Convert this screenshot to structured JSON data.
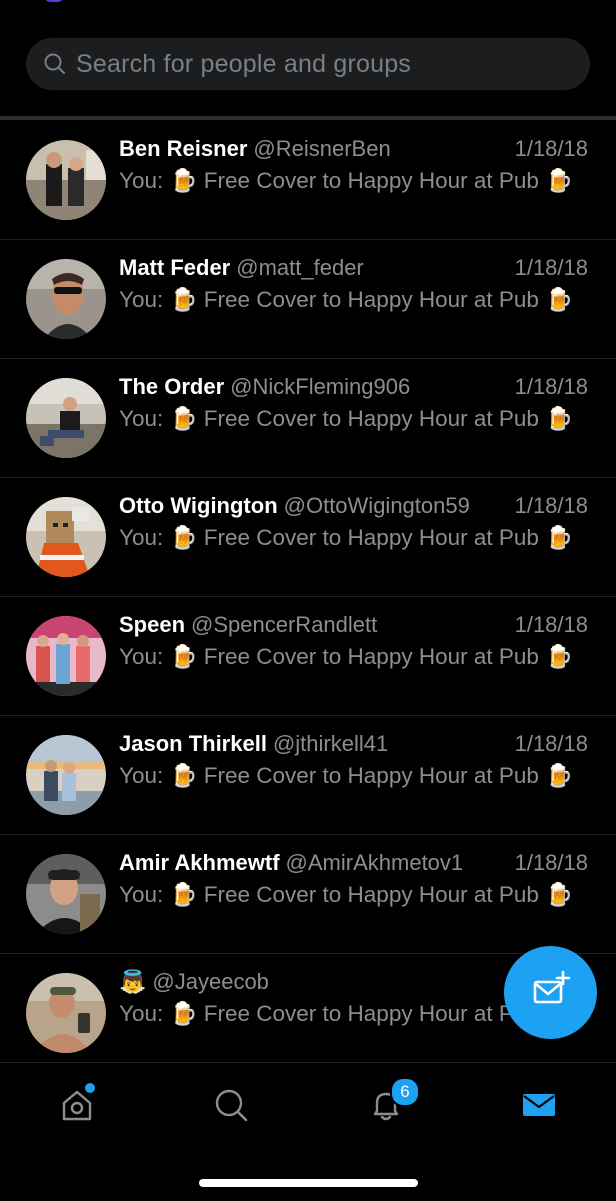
{
  "search": {
    "placeholder": "Search for people and groups",
    "icon": "search-icon"
  },
  "conversations": [
    {
      "name": "Ben Reisner",
      "handle": "@ReisnerBen",
      "date": "1/18/18",
      "preview": "You: 🍺 Free Cover to Happy Hour at Pub 🍺"
    },
    {
      "name": "Matt Feder",
      "handle": "@matt_feder",
      "date": "1/18/18",
      "preview": "You: 🍺 Free Cover to Happy Hour at Pub 🍺"
    },
    {
      "name": "The Order",
      "handle": "@NickFleming906",
      "date": "1/18/18",
      "preview": "You: 🍺 Free Cover to Happy Hour at Pub 🍺"
    },
    {
      "name": "Otto Wigington",
      "handle": "@OttoWigington59",
      "date": "1/18/18",
      "preview": "You: 🍺 Free Cover to Happy Hour at Pub 🍺"
    },
    {
      "name": "Speen",
      "handle": "@SpencerRandlett",
      "date": "1/18/18",
      "preview": "You: 🍺 Free Cover to Happy Hour at Pub 🍺"
    },
    {
      "name": "Jason Thirkell",
      "handle": "@jthirkell41",
      "date": "1/18/18",
      "preview": "You: 🍺 Free Cover to Happy Hour at Pub 🍺"
    },
    {
      "name": "Amir Akhmewtf",
      "handle": "@AmirAkhmetov1",
      "date": "1/18/18",
      "preview": "You: 🍺 Free Cover to Happy Hour at Pub 🍺"
    },
    {
      "name": "👼",
      "handle": "@Jayeecob",
      "date": "",
      "preview": "You: 🍺 Free Cover to Happy Hour at Pub 🍺"
    }
  ],
  "tabbar": {
    "tabs": [
      {
        "icon": "home-icon",
        "has_dot": true
      },
      {
        "icon": "search-icon"
      },
      {
        "icon": "bell-icon",
        "badge": "6"
      },
      {
        "icon": "mail-icon",
        "active": true
      }
    ]
  },
  "fab": {
    "icon": "new-message-icon"
  },
  "colors": {
    "accent": "#1da1f2",
    "background": "#000000",
    "muted_text": "#8a8f94",
    "search_bg": "#1b1d1f"
  }
}
